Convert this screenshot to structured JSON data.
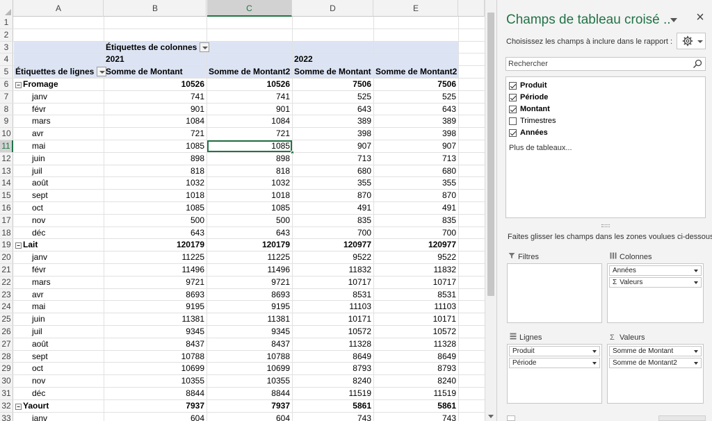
{
  "sheet": {
    "columns": [
      "A",
      "B",
      "C",
      "D",
      "E"
    ],
    "selected_column": "C",
    "selected_row": 11,
    "rows": [
      {
        "n": 1,
        "cells": []
      },
      {
        "n": 2,
        "cells": []
      },
      {
        "n": 3,
        "type": "header",
        "cells": [
          {
            "col": "B",
            "text": "Étiquettes de colonnes",
            "dd": true
          }
        ]
      },
      {
        "n": 4,
        "type": "header",
        "cells": [
          {
            "col": "B",
            "text": "2021"
          },
          {
            "col": "D",
            "text": "2022"
          }
        ]
      },
      {
        "n": 5,
        "type": "header",
        "cells": [
          {
            "col": "A",
            "text": "Étiquettes de lignes",
            "dd": true
          },
          {
            "col": "B",
            "text": "Somme de Montant"
          },
          {
            "col": "C",
            "text": "Somme de Montant2"
          },
          {
            "col": "D",
            "text": "Somme de Montant"
          },
          {
            "col": "E",
            "text": "Somme de Montant2"
          }
        ]
      },
      {
        "n": 6,
        "type": "group",
        "label": "Fromage",
        "vals": [
          "10526",
          "10526",
          "7506",
          "7506"
        ]
      },
      {
        "n": 7,
        "type": "item",
        "label": "janv",
        "vals": [
          "741",
          "741",
          "525",
          "525"
        ]
      },
      {
        "n": 8,
        "type": "item",
        "label": "févr",
        "vals": [
          "901",
          "901",
          "643",
          "643"
        ]
      },
      {
        "n": 9,
        "type": "item",
        "label": "mars",
        "vals": [
          "1084",
          "1084",
          "389",
          "389"
        ]
      },
      {
        "n": 10,
        "type": "item",
        "label": "avr",
        "vals": [
          "721",
          "721",
          "398",
          "398"
        ]
      },
      {
        "n": 11,
        "type": "item",
        "label": "mai",
        "vals": [
          "1085",
          "1085",
          "907",
          "907"
        ]
      },
      {
        "n": 12,
        "type": "item",
        "label": "juin",
        "vals": [
          "898",
          "898",
          "713",
          "713"
        ]
      },
      {
        "n": 13,
        "type": "item",
        "label": "juil",
        "vals": [
          "818",
          "818",
          "680",
          "680"
        ]
      },
      {
        "n": 14,
        "type": "item",
        "label": "août",
        "vals": [
          "1032",
          "1032",
          "355",
          "355"
        ]
      },
      {
        "n": 15,
        "type": "item",
        "label": "sept",
        "vals": [
          "1018",
          "1018",
          "870",
          "870"
        ]
      },
      {
        "n": 16,
        "type": "item",
        "label": "oct",
        "vals": [
          "1085",
          "1085",
          "491",
          "491"
        ]
      },
      {
        "n": 17,
        "type": "item",
        "label": "nov",
        "vals": [
          "500",
          "500",
          "835",
          "835"
        ]
      },
      {
        "n": 18,
        "type": "item",
        "label": "déc",
        "vals": [
          "643",
          "643",
          "700",
          "700"
        ]
      },
      {
        "n": 19,
        "type": "group",
        "label": "Lait",
        "vals": [
          "120179",
          "120179",
          "120977",
          "120977"
        ]
      },
      {
        "n": 20,
        "type": "item",
        "label": "janv",
        "vals": [
          "11225",
          "11225",
          "9522",
          "9522"
        ]
      },
      {
        "n": 21,
        "type": "item",
        "label": "févr",
        "vals": [
          "11496",
          "11496",
          "11832",
          "11832"
        ]
      },
      {
        "n": 22,
        "type": "item",
        "label": "mars",
        "vals": [
          "9721",
          "9721",
          "10717",
          "10717"
        ]
      },
      {
        "n": 23,
        "type": "item",
        "label": "avr",
        "vals": [
          "8693",
          "8693",
          "8531",
          "8531"
        ]
      },
      {
        "n": 24,
        "type": "item",
        "label": "mai",
        "vals": [
          "9195",
          "9195",
          "11103",
          "11103"
        ]
      },
      {
        "n": 25,
        "type": "item",
        "label": "juin",
        "vals": [
          "11381",
          "11381",
          "10171",
          "10171"
        ]
      },
      {
        "n": 26,
        "type": "item",
        "label": "juil",
        "vals": [
          "9345",
          "9345",
          "10572",
          "10572"
        ]
      },
      {
        "n": 27,
        "type": "item",
        "label": "août",
        "vals": [
          "8437",
          "8437",
          "11328",
          "11328"
        ]
      },
      {
        "n": 28,
        "type": "item",
        "label": "sept",
        "vals": [
          "10788",
          "10788",
          "8649",
          "8649"
        ]
      },
      {
        "n": 29,
        "type": "item",
        "label": "oct",
        "vals": [
          "10699",
          "10699",
          "8793",
          "8793"
        ]
      },
      {
        "n": 30,
        "type": "item",
        "label": "nov",
        "vals": [
          "10355",
          "10355",
          "8240",
          "8240"
        ]
      },
      {
        "n": 31,
        "type": "item",
        "label": "déc",
        "vals": [
          "8844",
          "8844",
          "11519",
          "11519"
        ]
      },
      {
        "n": 32,
        "type": "group",
        "label": "Yaourt",
        "vals": [
          "7937",
          "7937",
          "5861",
          "5861"
        ]
      },
      {
        "n": 33,
        "type": "item",
        "label": "janv",
        "vals": [
          "604",
          "604",
          "743",
          "743"
        ]
      }
    ],
    "expander_symbol": "⊟"
  },
  "pane": {
    "title": "Champs de tableau croisé ..",
    "close_label": "×",
    "subtitle": "Choisissez les champs à inclure dans le rapport :",
    "gear_icon": "gear-icon",
    "search_placeholder": "Rechercher",
    "fields": [
      {
        "label": "Produit",
        "checked": true
      },
      {
        "label": "Période",
        "checked": true
      },
      {
        "label": "Montant",
        "checked": true
      },
      {
        "label": "Trimestres",
        "checked": false
      },
      {
        "label": "Années",
        "checked": true
      }
    ],
    "more_tables": "Plus de tableaux...",
    "drag_hint": "Faites glisser les champs dans les zones voulues ci-dessous:",
    "zones": {
      "filters": {
        "title": "Filtres",
        "items": []
      },
      "columns": {
        "title": "Colonnes",
        "items": [
          "Années",
          "Valeurs"
        ]
      },
      "rows": {
        "title": "Lignes",
        "items": [
          "Produit",
          "Période"
        ]
      },
      "values": {
        "title": "Valeurs",
        "items": [
          "Somme de Montant",
          "Somme de Montant2"
        ]
      }
    },
    "sigma": "Σ"
  },
  "colors": {
    "accent": "#217346",
    "pivot_header_band": "#dce4f4"
  }
}
